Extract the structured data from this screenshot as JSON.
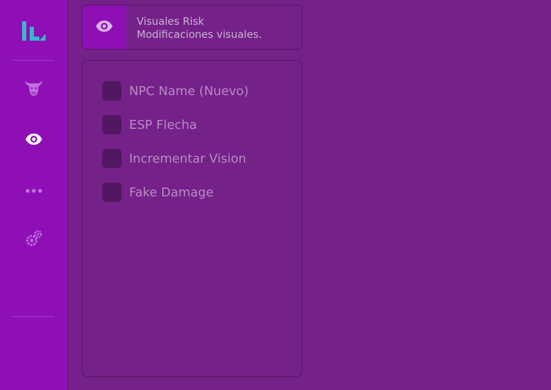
{
  "sidebar": {
    "icons": [
      "logo-icon",
      "bull-icon",
      "eye-icon",
      "more-dots-icon",
      "gears-icon"
    ]
  },
  "header": {
    "icon": "eye-icon",
    "title": "Visuales Risk",
    "subtitle": "Modificaciones visuales."
  },
  "options": [
    {
      "label": "NPC Name (Nuevo)",
      "checked": false
    },
    {
      "label": "ESP Flecha",
      "checked": false
    },
    {
      "label": "Incrementar Vision",
      "checked": false
    },
    {
      "label": "Fake Damage",
      "checked": false
    }
  ],
  "colors": {
    "background": "#75218a",
    "sidebar": "#8f0fb7",
    "accent_active": "#ffffff",
    "icon_muted": "#c070e0",
    "logo_cyan": "#36b9c9",
    "checkbox": "#521761",
    "text_muted": "#b98bc4"
  }
}
